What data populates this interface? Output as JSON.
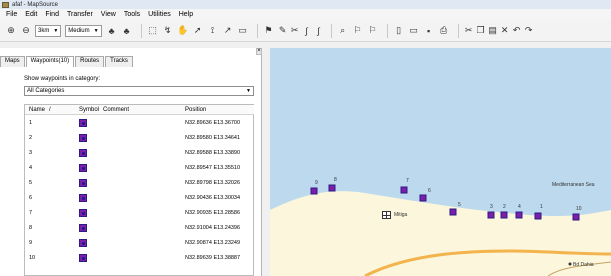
{
  "window": {
    "title": "afaf - MapSource"
  },
  "menu": [
    "File",
    "Edit",
    "Find",
    "Transfer",
    "View",
    "Tools",
    "Utilities",
    "Help"
  ],
  "toolbar": {
    "scale": "3km",
    "detail": "Medium"
  },
  "tabs": [
    "Maps",
    "Waypoints(10)",
    "Routes",
    "Tracks"
  ],
  "panel": {
    "category_label": "Show waypoints in category:",
    "category_value": "All Categories",
    "columns": [
      "Name",
      "/",
      "Symbol",
      "Comment",
      "Position"
    ],
    "rows": [
      {
        "name": "1",
        "position": "N32.89636 E13.36700"
      },
      {
        "name": "2",
        "position": "N32.89580 E13.34641"
      },
      {
        "name": "3",
        "position": "N32.89588 E13.33890"
      },
      {
        "name": "4",
        "position": "N32.89547 E13.35510"
      },
      {
        "name": "5",
        "position": "N32.89798 E13.32026"
      },
      {
        "name": "6",
        "position": "N32.90436 E13.30034"
      },
      {
        "name": "7",
        "position": "N32.90935 E13.28586"
      },
      {
        "name": "8",
        "position": "N32.91004 E13.24396"
      },
      {
        "name": "9",
        "position": "N32.90874 E13.23249"
      },
      {
        "name": "10",
        "position": "N32.89639 E13.38887"
      }
    ]
  },
  "map": {
    "sea_label": "Mediterranean Sea",
    "city_label": "Mitiga",
    "place_label": "Bd Dahia",
    "waypoints": [
      "9",
      "8",
      "7",
      "6",
      "5",
      "3",
      "2",
      "4",
      "1",
      "10"
    ],
    "colors": {
      "sea": "#bcd9ee",
      "land": "#fbf6dc",
      "road": "#f3b34d",
      "waypoint": "#7b1ea8"
    }
  }
}
